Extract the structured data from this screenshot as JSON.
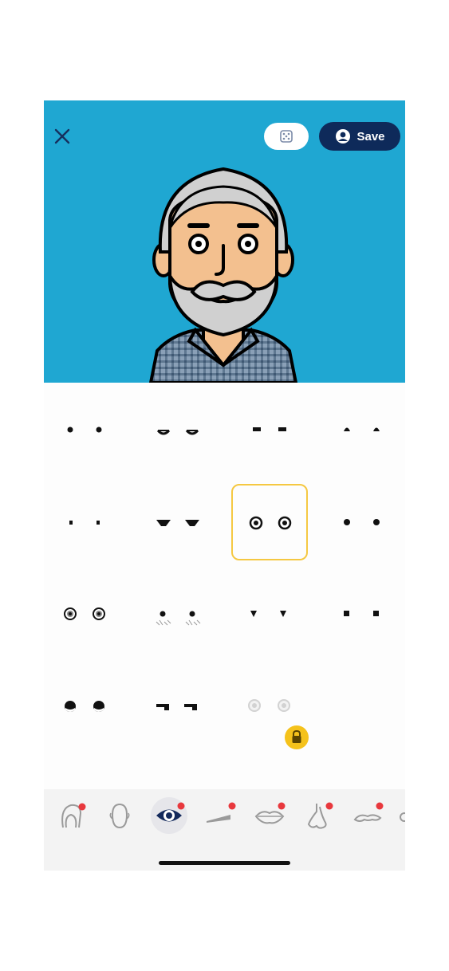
{
  "header": {
    "close_icon": "close-icon",
    "customize_icon": "dice-icon",
    "save_label": "Save",
    "save_icon": "user-circle-icon"
  },
  "colors": {
    "preview_background": "#1fa7d2",
    "save_button": "#0e2a5a",
    "selection_border": "#f5c842",
    "badge": "#e8383d",
    "lock_badge": "#f5c21b",
    "active_tab_icon": "#142a5c"
  },
  "eye_options": [
    {
      "id": "dots-small",
      "selected": false,
      "locked": false
    },
    {
      "id": "sleepy-lids",
      "selected": false,
      "locked": false
    },
    {
      "id": "dash",
      "selected": false,
      "locked": false
    },
    {
      "id": "dots-top",
      "selected": false,
      "locked": false
    },
    {
      "id": "tiny-dots",
      "selected": false,
      "locked": false
    },
    {
      "id": "angry-lids",
      "selected": false,
      "locked": false
    },
    {
      "id": "round-outlined",
      "selected": true,
      "locked": false
    },
    {
      "id": "dots-medium",
      "selected": false,
      "locked": false
    },
    {
      "id": "target-rings",
      "selected": false,
      "locked": false
    },
    {
      "id": "dots-with-lashes",
      "selected": false,
      "locked": false
    },
    {
      "id": "triangle-down",
      "selected": false,
      "locked": false
    },
    {
      "id": "squares",
      "selected": false,
      "locked": false
    },
    {
      "id": "glossy",
      "selected": false,
      "locked": false
    },
    {
      "id": "side-glance",
      "selected": false,
      "locked": false
    },
    {
      "id": "faded-rings",
      "selected": false,
      "locked": true
    }
  ],
  "categories": [
    {
      "icon": "hair-icon",
      "badge": true,
      "active": false
    },
    {
      "icon": "face-shape-icon",
      "badge": false,
      "active": false
    },
    {
      "icon": "eye-icon",
      "badge": true,
      "active": true
    },
    {
      "icon": "eyebrow-icon",
      "badge": true,
      "active": false
    },
    {
      "icon": "mouth-icon",
      "badge": true,
      "active": false
    },
    {
      "icon": "nose-icon",
      "badge": true,
      "active": false
    },
    {
      "icon": "mustache-icon",
      "badge": true,
      "active": false
    },
    {
      "icon": "more-icon",
      "badge": false,
      "active": false
    }
  ]
}
